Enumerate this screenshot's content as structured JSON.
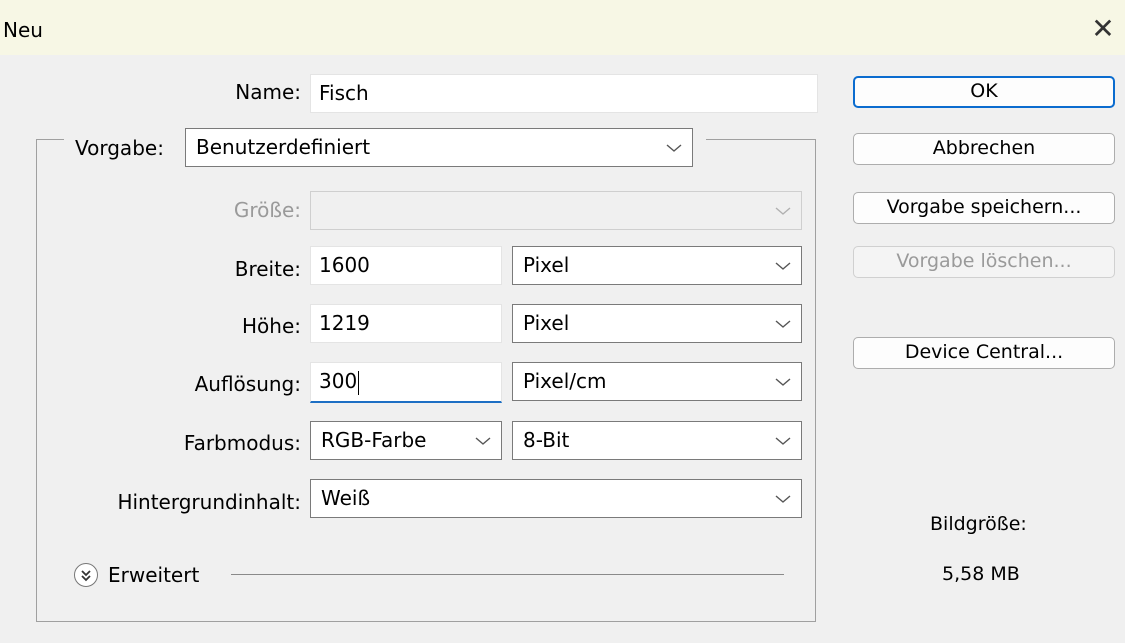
{
  "window": {
    "title": "Neu",
    "close_glyph": "✕"
  },
  "form": {
    "name_label": "Name:",
    "name_value": "Fisch",
    "preset_label": "Vorgabe:",
    "preset_value": "Benutzerdefiniert",
    "size_label": "Größe:",
    "size_value": "",
    "width_label": "Breite:",
    "width_value": "1600",
    "width_unit": "Pixel",
    "height_label": "Höhe:",
    "height_value": "1219",
    "height_unit": "Pixel",
    "resolution_label": "Auflösung:",
    "resolution_value": "300",
    "resolution_unit": "Pixel/cm",
    "color_mode_label": "Farbmodus:",
    "color_mode_value": "RGB-Farbe",
    "bit_depth_value": "8-Bit",
    "background_label": "Hintergrundinhalt:",
    "background_value": "Weiß",
    "advanced_label": "Erweitert"
  },
  "buttons": {
    "ok": "OK",
    "cancel": "Abbrechen",
    "save_preset": "Vorgabe speichern...",
    "delete_preset": "Vorgabe löschen...",
    "device_central": "Device Central..."
  },
  "image_size": {
    "label": "Bildgröße:",
    "value": "5,58 MB"
  },
  "icons": {
    "close": "close-icon",
    "dropdown": "chevron-down-icon",
    "expand": "double-chevron-down-icon"
  },
  "colors": {
    "accent": "#0b6ccf",
    "titlebar": "#f7f7e5",
    "dialog_bg": "#f0f0f0"
  }
}
